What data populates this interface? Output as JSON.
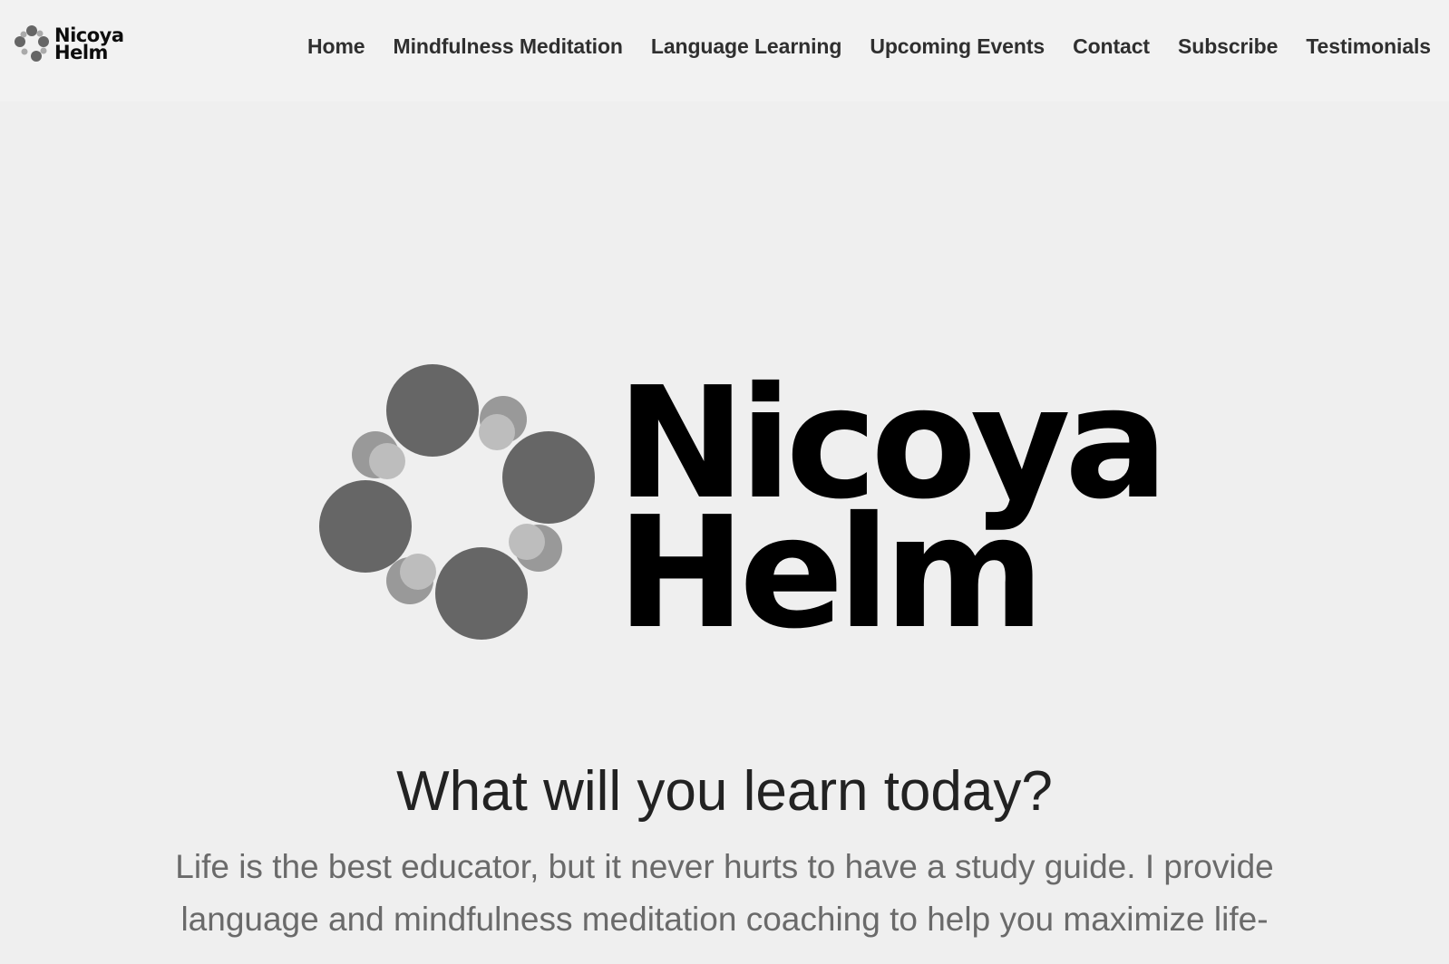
{
  "brand": {
    "name_line1": "Nicoya",
    "name_line2": "Helm"
  },
  "nav": {
    "items": [
      {
        "label": "Home"
      },
      {
        "label": "Mindfulness Meditation"
      },
      {
        "label": "Language Learning"
      },
      {
        "label": "Upcoming Events"
      },
      {
        "label": "Contact"
      },
      {
        "label": "Subscribe"
      },
      {
        "label": "Testimonials"
      }
    ]
  },
  "hero": {
    "logo_line1": "Nicoya",
    "logo_line2": "Helm",
    "headline": "What will you learn today?",
    "intro": "Life is the best educator, but it never hurts to have a study guide. I provide language and mindfulness meditation coaching to help you maximize life-"
  },
  "colors": {
    "background": "#efefef",
    "header_background": "#f2f2f2",
    "dark_circle": "#666666",
    "light_circle": "#a9a9a9",
    "text_dark": "#222222",
    "text_muted": "#6a6a6a"
  }
}
